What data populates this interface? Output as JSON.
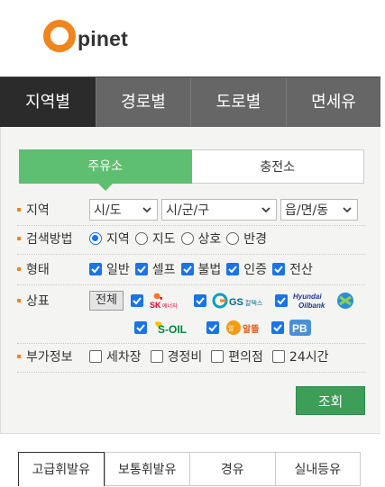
{
  "header": {
    "logo_text": "pinet"
  },
  "main_tabs": [
    {
      "label": "지역별",
      "active": true
    },
    {
      "label": "경로별",
      "active": false
    },
    {
      "label": "도로별",
      "active": false
    },
    {
      "label": "면세유",
      "active": false
    }
  ],
  "sub_tabs": [
    {
      "label": "주유소",
      "active": true
    },
    {
      "label": "충전소",
      "active": false
    }
  ],
  "region": {
    "label": "지역",
    "selects": [
      "시/도",
      "시/군/구",
      "읍/면/동"
    ]
  },
  "search_method": {
    "label": "검색방법",
    "options": [
      {
        "label": "지역",
        "checked": true
      },
      {
        "label": "지도",
        "checked": false
      },
      {
        "label": "상호",
        "checked": false
      },
      {
        "label": "반경",
        "checked": false
      }
    ]
  },
  "type": {
    "label": "형태",
    "options": [
      {
        "label": "일반",
        "checked": true
      },
      {
        "label": "셀프",
        "checked": true
      },
      {
        "label": "불법",
        "checked": true
      },
      {
        "label": "인증",
        "checked": true
      },
      {
        "label": "전산",
        "checked": true
      }
    ]
  },
  "brand": {
    "label": "상표",
    "all_button": "전체",
    "brands": [
      {
        "name": "SK에너지",
        "text": "SK에너지"
      },
      {
        "name": "GS칼텍스",
        "text": "GS칼텍스"
      },
      {
        "name": "Hyundai Oilbank",
        "text": "Hyundai Oilbank"
      },
      {
        "name": "S-OIL",
        "text": "S-OIL"
      },
      {
        "name": "알뜰",
        "text": "알뜰"
      },
      {
        "name": "PB",
        "text": "PB"
      }
    ]
  },
  "extra": {
    "label": "부가정보",
    "options": [
      {
        "label": "세차장",
        "checked": false
      },
      {
        "label": "경정비",
        "checked": false
      },
      {
        "label": "편의점",
        "checked": false
      },
      {
        "label": "24시간",
        "checked": false
      }
    ]
  },
  "search_button": "조회",
  "fuel_tabs": [
    {
      "label": "고급휘발유",
      "active": true
    },
    {
      "label": "보통휘발유",
      "active": false
    },
    {
      "label": "경유",
      "active": false
    },
    {
      "label": "실내등유",
      "active": false
    }
  ],
  "colors": {
    "accent_orange": "#f0851e",
    "sub_tab_green": "#5fbf70",
    "search_green": "#3d9e57",
    "checkbox_blue": "#1a73e8",
    "tab_dark": "#2b2b2b",
    "tab_gray": "#666666"
  }
}
